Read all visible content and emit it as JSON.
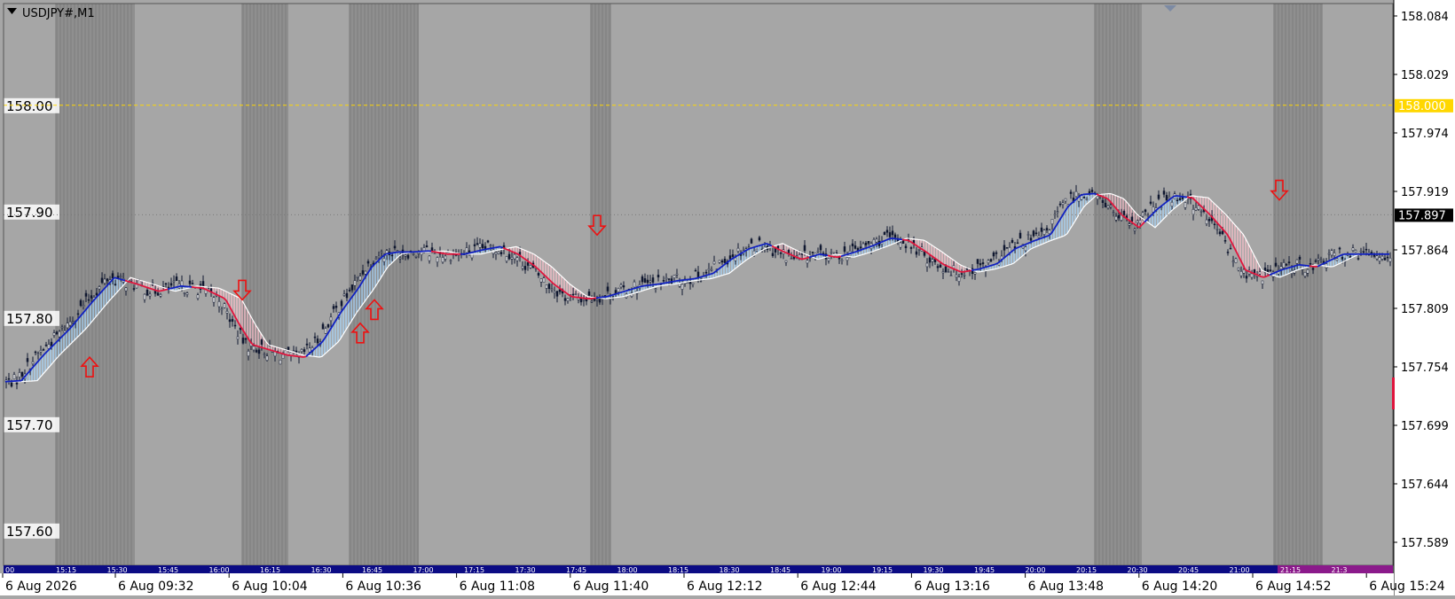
{
  "title": "USDJPY#,M1",
  "chart_data": {
    "type": "candlestick",
    "symbol": "USDJPY#",
    "timeframe": "M1",
    "ylim": [
      157.56,
      158.1
    ],
    "y_ticks": [
      "158.084",
      "158.029",
      "157.974",
      "157.919",
      "157.864",
      "157.809",
      "157.754",
      "157.699",
      "157.644",
      "157.589"
    ],
    "left_levels": [
      {
        "label": "158.00",
        "value": 158.0
      },
      {
        "label": "157.90",
        "value": 157.9
      },
      {
        "label": "157.80",
        "value": 157.8
      },
      {
        "label": "157.70",
        "value": 157.7
      },
      {
        "label": "157.60",
        "value": 157.6
      }
    ],
    "hline": {
      "value": 158.0,
      "label": "158.000",
      "color": "#ffd700"
    },
    "current_price": {
      "value": 157.897,
      "label": "157.897"
    },
    "date_labels": [
      "6 Aug 2026",
      "6 Aug 09:32",
      "6 Aug 10:04",
      "6 Aug 10:36",
      "6 Aug 11:08",
      "6 Aug 11:40",
      "6 Aug 12:12",
      "6 Aug 12:44",
      "6 Aug 13:16",
      "6 Aug 13:48",
      "6 Aug 14:20",
      "6 Aug 14:52",
      "6 Aug 15:24"
    ],
    "session_labels": [
      "00",
      "15:15",
      "15:30",
      "15:45",
      "16:00",
      "16:15",
      "16:30",
      "16:45",
      "17:00",
      "17:15",
      "17:30",
      "17:45",
      "18:00",
      "18:15",
      "18:30",
      "18:45",
      "19:00",
      "19:15",
      "19:30",
      "19:45",
      "20:00",
      "20:15",
      "20:30",
      "20:45",
      "21:00",
      "21:15",
      "21:3"
    ],
    "trend": {
      "x": [
        0,
        20,
        45,
        75,
        100,
        125,
        150,
        175,
        200,
        225,
        250,
        265,
        280,
        300,
        320,
        340,
        360,
        380,
        400,
        415,
        430,
        445,
        460,
        480,
        500,
        520,
        540,
        560,
        580,
        600,
        620,
        640,
        660,
        680,
        700,
        720,
        740,
        760,
        780,
        800,
        820,
        840,
        860,
        880,
        900,
        920,
        940,
        960,
        980,
        1000,
        1020,
        1040,
        1060,
        1080,
        1100,
        1120,
        1140,
        1160,
        1180,
        1200,
        1215,
        1230,
        1245,
        1260,
        1280,
        1300,
        1320,
        1340,
        1360,
        1380,
        1400,
        1420,
        1440,
        1460,
        1480,
        1500,
        1510
      ],
      "y": [
        157.74,
        157.741,
        157.765,
        157.79,
        157.815,
        157.838,
        157.832,
        157.825,
        157.83,
        157.828,
        157.818,
        157.795,
        157.775,
        157.77,
        157.765,
        157.763,
        157.778,
        157.805,
        157.828,
        157.848,
        157.86,
        157.862,
        157.862,
        157.863,
        157.86,
        157.86,
        157.864,
        157.867,
        157.86,
        157.848,
        157.832,
        157.82,
        157.818,
        157.82,
        157.825,
        157.83,
        157.832,
        157.835,
        157.837,
        157.842,
        157.855,
        157.865,
        157.87,
        157.862,
        157.855,
        157.86,
        157.857,
        157.862,
        157.868,
        157.875,
        157.873,
        157.862,
        157.85,
        157.843,
        157.846,
        157.851,
        157.865,
        157.872,
        157.878,
        157.905,
        157.916,
        157.917,
        157.912,
        157.897,
        157.885,
        157.902,
        157.915,
        157.913,
        157.897,
        157.878,
        157.845,
        157.838,
        157.845,
        157.85,
        157.848,
        157.856,
        157.86
      ]
    },
    "signals": [
      {
        "dir": "up",
        "x": 101,
        "value": 157.753
      },
      {
        "dir": "down",
        "x": 273,
        "value": 157.827
      },
      {
        "dir": "up",
        "x": 406,
        "value": 157.785
      },
      {
        "dir": "up",
        "x": 422,
        "value": 157.807
      },
      {
        "dir": "down",
        "x": 673,
        "value": 157.888
      },
      {
        "dir": "down",
        "x": 1442,
        "value": 157.921
      }
    ],
    "shaded_ranges": [
      [
        62,
        152
      ],
      [
        272,
        325
      ],
      [
        393,
        472
      ],
      [
        665,
        689
      ],
      [
        1233,
        1287
      ],
      [
        1435,
        1491
      ]
    ]
  }
}
